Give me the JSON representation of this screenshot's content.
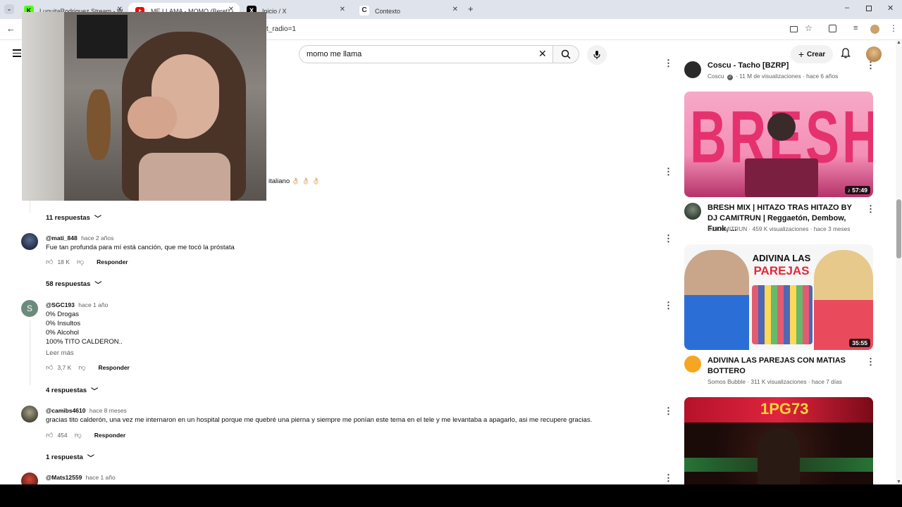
{
  "browser": {
    "tabs": [
      {
        "title": "LuquitaRodriguez Stream - Wa",
        "active": false
      },
      {
        "title": "ME LLAMA - MOMO (Beret) - Yo",
        "active": true
      },
      {
        "title": "Inicio / X",
        "active": false
      },
      {
        "title": "Contexto",
        "active": false
      }
    ],
    "url_fragment": "t_radio=1",
    "new_tab_label": "+"
  },
  "header": {
    "search_value": "momo me llama",
    "create_label": "Crear"
  },
  "comments": [
    {
      "partial_text": "italiano 👌🏻 👌🏻 👌🏻",
      "replies_label": "11 respuestas"
    },
    {
      "user": "@mati_848",
      "time": "hace 2 años",
      "lines": [
        "Fue tan profunda para mí está canción, que me tocó la próstata"
      ],
      "likes": "18 K",
      "reply_label": "Responder",
      "replies_label": "58 respuestas"
    },
    {
      "user": "@SGC193",
      "time": "hace 1 año",
      "avatar_letter": "S",
      "lines": [
        "0% Drogas",
        "0% Insultos",
        "0% Alcohol",
        "100% TITO CALDERON.."
      ],
      "read_more": "Leer más",
      "likes": "3,7 K",
      "reply_label": "Responder",
      "replies_label": "4 respuestas"
    },
    {
      "user": "@camibs4610",
      "time": "hace 8 meses",
      "lines": [
        "gracias tito calderón, una vez me internaron en un hospital porque me quebré una pierna y siempre me ponían este tema en el tele y me levantaba a apagarlo, asi me recupere gracias."
      ],
      "likes": "454",
      "reply_label": "Responder",
      "replies_label": "1 respuesta"
    },
    {
      "user": "@Mats12559",
      "time": "hace 1 año"
    }
  ],
  "sidebar": {
    "videos": [
      {
        "title": "Coscu - Tacho [BZRP]",
        "channel": "Coscu",
        "verified": true,
        "views": "11 M de visualizaciones",
        "age": "hace 6 años"
      },
      {
        "title": "BRESH MIX | HITAZO TRAS HITAZO BY DJ CAMITRUN | Reggaetón, Dembow, Funk, ...",
        "thumb_text": "BRESH",
        "duration": "57:49",
        "channel": "DJ CAMITRUN",
        "views": "459 K visualizaciones",
        "age": "hace 3 meses"
      },
      {
        "title": "ADIVINA LAS PAREJAS CON MATIAS BOTTERO",
        "thumb_text_1": "ADIVINA LAS",
        "thumb_text_2": "PAREJAS",
        "duration": "35:55",
        "channel": "Somos Bubble",
        "views": "311 K visualizaciones",
        "age": "hace 7 días"
      },
      {
        "title": "",
        "thumb_text": "1PG73"
      }
    ]
  }
}
